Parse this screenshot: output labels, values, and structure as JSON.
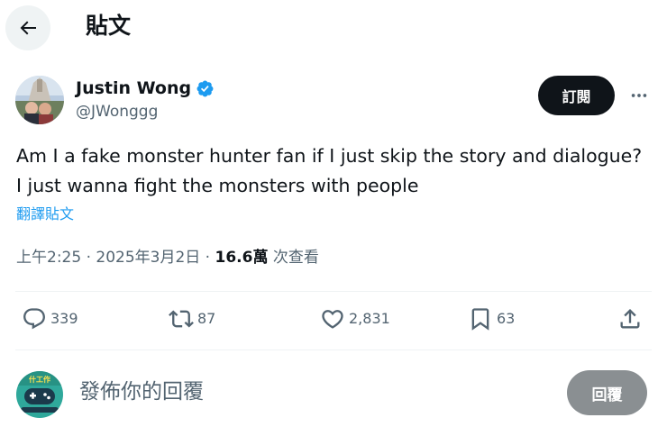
{
  "header": {
    "title": "貼文"
  },
  "author": {
    "display_name": "Justin Wong",
    "handle": "@JWonggg",
    "follow_label": "訂閱"
  },
  "tweet": {
    "text": "Am I a fake monster hunter fan if I just skip the story and dialogue?  I just wanna fight the monsters with people",
    "translate_label": "翻譯貼文",
    "time": "上午2:25 · 2025年3月2日 · ",
    "views_count": "16.6萬",
    "views_label": " 次查看"
  },
  "actions": {
    "replies": "339",
    "retweets": "87",
    "likes": "2,831",
    "bookmarks": "63"
  },
  "reply": {
    "placeholder": "發佈你的回覆",
    "button_label": "回覆",
    "avatar_text": "什工作"
  },
  "colors": {
    "text_primary": "#0f1419",
    "text_secondary": "#536471",
    "accent_blue": "#1d9bf0",
    "follow_bg": "#0f1419",
    "reply_btn_bg": "#8a8f92",
    "divider": "#eff3f4"
  },
  "icons": [
    "back-arrow-icon",
    "verified-badge-icon",
    "more-icon",
    "reply-icon",
    "retweet-icon",
    "like-icon",
    "bookmark-icon",
    "share-icon"
  ]
}
